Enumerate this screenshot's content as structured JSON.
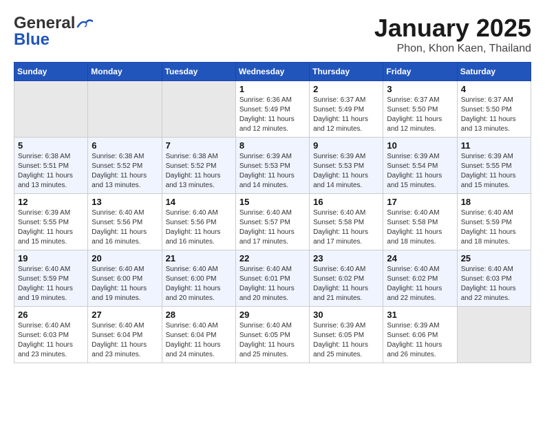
{
  "header": {
    "logo_line1": "General",
    "logo_line2": "Blue",
    "title": "January 2025",
    "subtitle": "Phon, Khon Kaen, Thailand"
  },
  "weekdays": [
    "Sunday",
    "Monday",
    "Tuesday",
    "Wednesday",
    "Thursday",
    "Friday",
    "Saturday"
  ],
  "weeks": [
    [
      {
        "day": "",
        "info": ""
      },
      {
        "day": "",
        "info": ""
      },
      {
        "day": "",
        "info": ""
      },
      {
        "day": "1",
        "info": "Sunrise: 6:36 AM\nSunset: 5:49 PM\nDaylight: 11 hours\nand 12 minutes."
      },
      {
        "day": "2",
        "info": "Sunrise: 6:37 AM\nSunset: 5:49 PM\nDaylight: 11 hours\nand 12 minutes."
      },
      {
        "day": "3",
        "info": "Sunrise: 6:37 AM\nSunset: 5:50 PM\nDaylight: 11 hours\nand 12 minutes."
      },
      {
        "day": "4",
        "info": "Sunrise: 6:37 AM\nSunset: 5:50 PM\nDaylight: 11 hours\nand 13 minutes."
      }
    ],
    [
      {
        "day": "5",
        "info": "Sunrise: 6:38 AM\nSunset: 5:51 PM\nDaylight: 11 hours\nand 13 minutes."
      },
      {
        "day": "6",
        "info": "Sunrise: 6:38 AM\nSunset: 5:52 PM\nDaylight: 11 hours\nand 13 minutes."
      },
      {
        "day": "7",
        "info": "Sunrise: 6:38 AM\nSunset: 5:52 PM\nDaylight: 11 hours\nand 13 minutes."
      },
      {
        "day": "8",
        "info": "Sunrise: 6:39 AM\nSunset: 5:53 PM\nDaylight: 11 hours\nand 14 minutes."
      },
      {
        "day": "9",
        "info": "Sunrise: 6:39 AM\nSunset: 5:53 PM\nDaylight: 11 hours\nand 14 minutes."
      },
      {
        "day": "10",
        "info": "Sunrise: 6:39 AM\nSunset: 5:54 PM\nDaylight: 11 hours\nand 15 minutes."
      },
      {
        "day": "11",
        "info": "Sunrise: 6:39 AM\nSunset: 5:55 PM\nDaylight: 11 hours\nand 15 minutes."
      }
    ],
    [
      {
        "day": "12",
        "info": "Sunrise: 6:39 AM\nSunset: 5:55 PM\nDaylight: 11 hours\nand 15 minutes."
      },
      {
        "day": "13",
        "info": "Sunrise: 6:40 AM\nSunset: 5:56 PM\nDaylight: 11 hours\nand 16 minutes."
      },
      {
        "day": "14",
        "info": "Sunrise: 6:40 AM\nSunset: 5:56 PM\nDaylight: 11 hours\nand 16 minutes."
      },
      {
        "day": "15",
        "info": "Sunrise: 6:40 AM\nSunset: 5:57 PM\nDaylight: 11 hours\nand 17 minutes."
      },
      {
        "day": "16",
        "info": "Sunrise: 6:40 AM\nSunset: 5:58 PM\nDaylight: 11 hours\nand 17 minutes."
      },
      {
        "day": "17",
        "info": "Sunrise: 6:40 AM\nSunset: 5:58 PM\nDaylight: 11 hours\nand 18 minutes."
      },
      {
        "day": "18",
        "info": "Sunrise: 6:40 AM\nSunset: 5:59 PM\nDaylight: 11 hours\nand 18 minutes."
      }
    ],
    [
      {
        "day": "19",
        "info": "Sunrise: 6:40 AM\nSunset: 5:59 PM\nDaylight: 11 hours\nand 19 minutes."
      },
      {
        "day": "20",
        "info": "Sunrise: 6:40 AM\nSunset: 6:00 PM\nDaylight: 11 hours\nand 19 minutes."
      },
      {
        "day": "21",
        "info": "Sunrise: 6:40 AM\nSunset: 6:00 PM\nDaylight: 11 hours\nand 20 minutes."
      },
      {
        "day": "22",
        "info": "Sunrise: 6:40 AM\nSunset: 6:01 PM\nDaylight: 11 hours\nand 20 minutes."
      },
      {
        "day": "23",
        "info": "Sunrise: 6:40 AM\nSunset: 6:02 PM\nDaylight: 11 hours\nand 21 minutes."
      },
      {
        "day": "24",
        "info": "Sunrise: 6:40 AM\nSunset: 6:02 PM\nDaylight: 11 hours\nand 22 minutes."
      },
      {
        "day": "25",
        "info": "Sunrise: 6:40 AM\nSunset: 6:03 PM\nDaylight: 11 hours\nand 22 minutes."
      }
    ],
    [
      {
        "day": "26",
        "info": "Sunrise: 6:40 AM\nSunset: 6:03 PM\nDaylight: 11 hours\nand 23 minutes."
      },
      {
        "day": "27",
        "info": "Sunrise: 6:40 AM\nSunset: 6:04 PM\nDaylight: 11 hours\nand 23 minutes."
      },
      {
        "day": "28",
        "info": "Sunrise: 6:40 AM\nSunset: 6:04 PM\nDaylight: 11 hours\nand 24 minutes."
      },
      {
        "day": "29",
        "info": "Sunrise: 6:40 AM\nSunset: 6:05 PM\nDaylight: 11 hours\nand 25 minutes."
      },
      {
        "day": "30",
        "info": "Sunrise: 6:39 AM\nSunset: 6:05 PM\nDaylight: 11 hours\nand 25 minutes."
      },
      {
        "day": "31",
        "info": "Sunrise: 6:39 AM\nSunset: 6:06 PM\nDaylight: 11 hours\nand 26 minutes."
      },
      {
        "day": "",
        "info": ""
      }
    ]
  ]
}
